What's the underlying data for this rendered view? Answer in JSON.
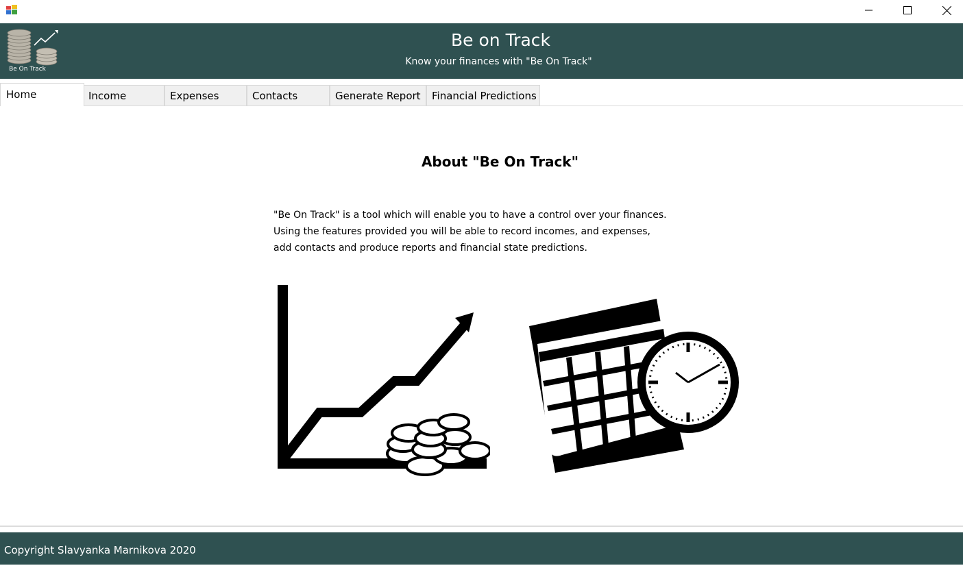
{
  "window": {
    "icon": "app-window-icon",
    "controls": {
      "minimize_icon": "minimize-icon",
      "maximize_icon": "maximize-icon",
      "close_icon": "close-icon"
    }
  },
  "header": {
    "logo_caption": "Be On Track",
    "title": "Be on Track",
    "subtitle": "Know your finances with \"Be On Track\"",
    "background_color": "#2f5151"
  },
  "tabs": [
    {
      "label": "Home",
      "selected": true
    },
    {
      "label": "Income",
      "selected": false
    },
    {
      "label": "Expenses",
      "selected": false
    },
    {
      "label": "Contacts",
      "selected": false
    },
    {
      "label": "Generate Report",
      "selected": false
    },
    {
      "label": "Financial Predictions",
      "selected": false
    }
  ],
  "main": {
    "heading": "About \"Be On Track\"",
    "description_lines": [
      "\"Be  On Track\" is a tool which will enable you to have a control over your finances.",
      "Using the features provided you will be able to record incomes, and expenses,",
      "add contacts and produce reports and financial state predictions."
    ],
    "images": [
      "growth-chart-with-coins-icon",
      "calendar-with-clock-icon"
    ]
  },
  "footer": {
    "copyright": "Copyright Slavyanka Marnikova 2020"
  }
}
